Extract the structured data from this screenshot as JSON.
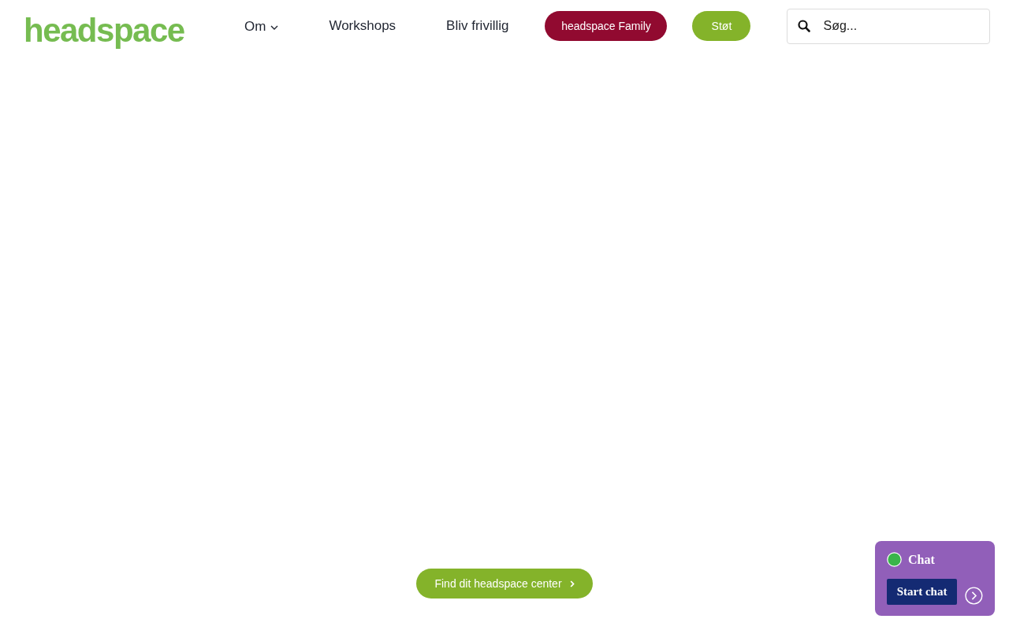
{
  "header": {
    "logo": "headspace",
    "nav": [
      {
        "label": "Om",
        "kind": "dropdown"
      },
      {
        "label": "Workshops",
        "kind": "link"
      },
      {
        "label": "Bliv frivillig",
        "kind": "link"
      }
    ],
    "buttons": [
      {
        "label": "headspace Family",
        "kind": "family"
      },
      {
        "label": "Støt",
        "kind": "support"
      }
    ],
    "search": {
      "placeholder": "Søg..."
    }
  },
  "main": {
    "cta": "Find dit headspace center"
  },
  "chat_widget": {
    "title": "Chat",
    "button": "Start chat"
  }
}
